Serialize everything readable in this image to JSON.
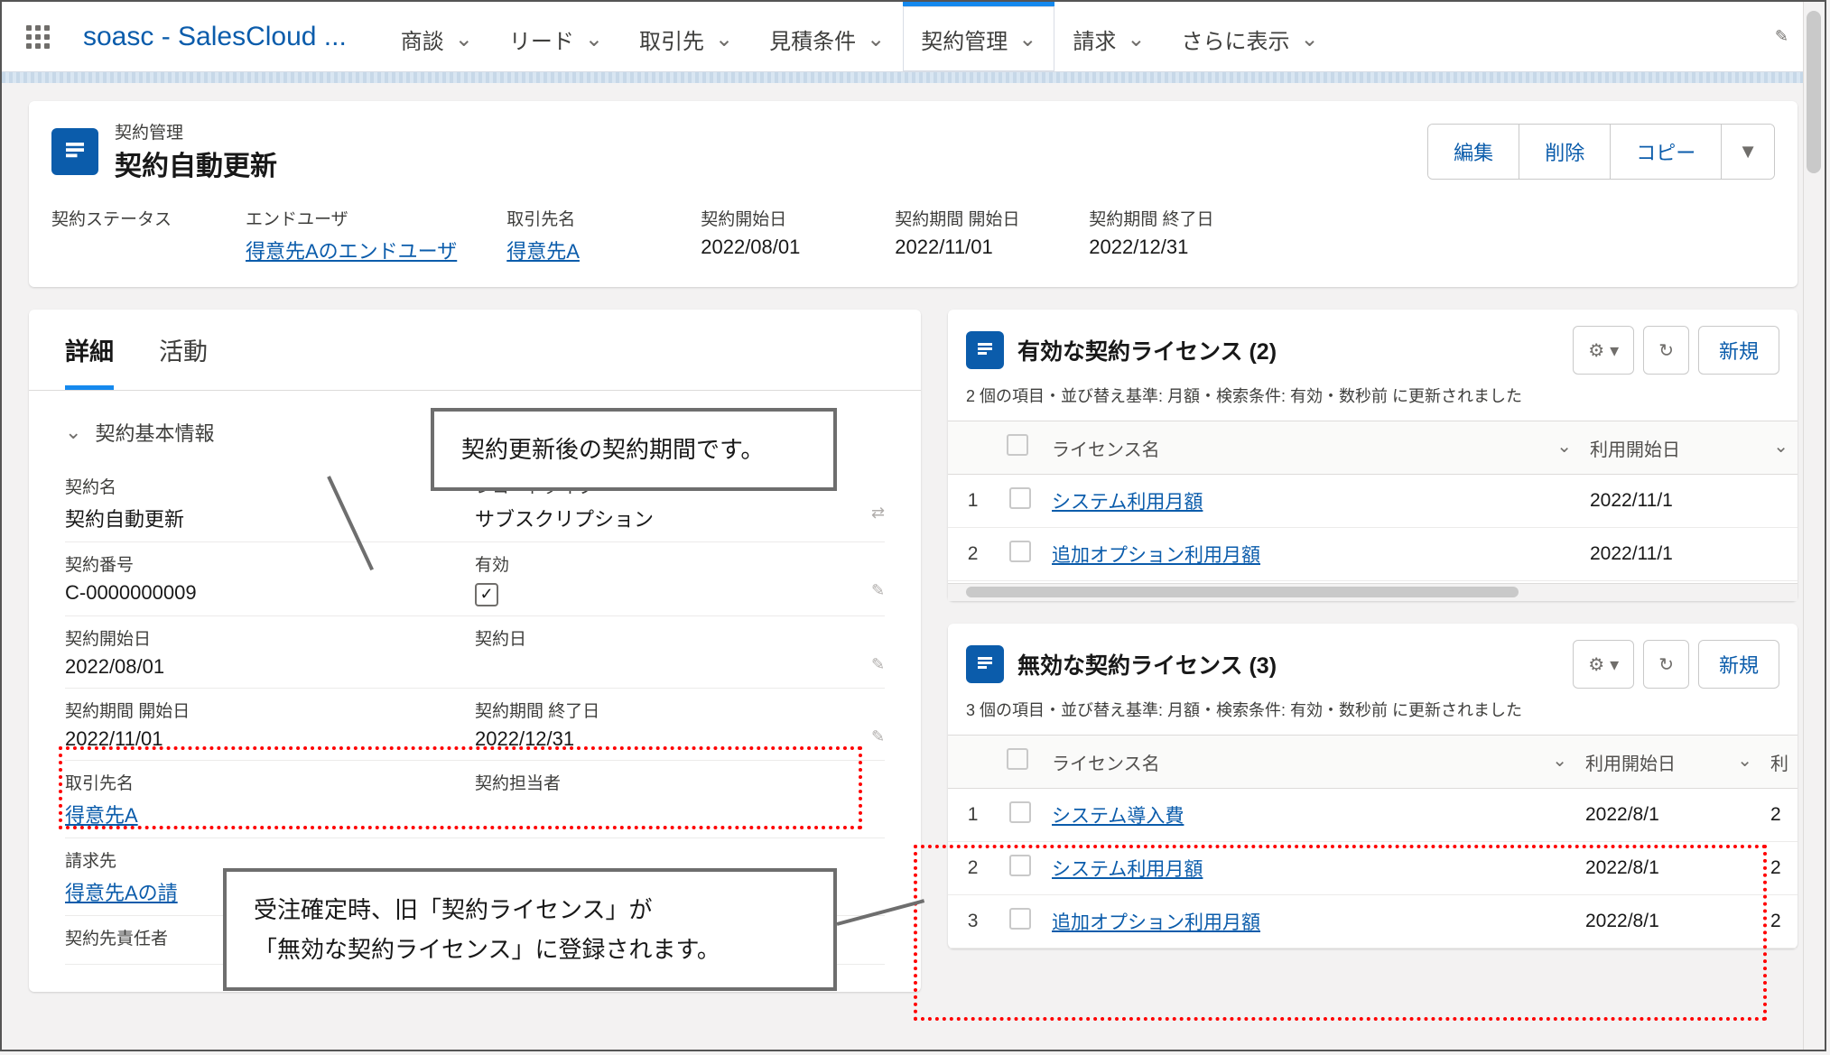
{
  "app": {
    "name": "soasc - SalesCloud ..."
  },
  "nav": {
    "items": [
      {
        "label": "商談"
      },
      {
        "label": "リード"
      },
      {
        "label": "取引先"
      },
      {
        "label": "見積条件"
      },
      {
        "label": "契約管理",
        "active": true
      },
      {
        "label": "請求"
      },
      {
        "label": "さらに表示"
      }
    ]
  },
  "record": {
    "object": "契約管理",
    "name": "契約自動更新",
    "actions": {
      "edit": "編集",
      "delete": "削除",
      "copy": "コピー"
    },
    "summary": {
      "status_lbl": "契約ステータス",
      "status_val": "",
      "enduser_lbl": "エンドユーザ",
      "enduser_val": "得意先Aのエンドユーザ",
      "account_lbl": "取引先名",
      "account_val": "得意先A",
      "start_lbl": "契約開始日",
      "start_val": "2022/08/01",
      "period_start_lbl": "契約期間 開始日",
      "period_start_val": "2022/11/01",
      "period_end_lbl": "契約期間 終了日",
      "period_end_val": "2022/12/31"
    }
  },
  "tabs": {
    "detail": "詳細",
    "activity": "活動"
  },
  "section": {
    "title": "契約基本情報"
  },
  "details": {
    "name_lbl": "契約名",
    "name_val": "契約自動更新",
    "rectype_lbl": "レコードタイプ",
    "rectype_val": "サブスクリプション",
    "num_lbl": "契約番号",
    "num_val": "C-0000000009",
    "valid_lbl": "有効",
    "startdate_lbl": "契約開始日",
    "startdate_val": "2022/08/01",
    "contractdate_lbl": "契約日",
    "period_start_lbl": "契約期間 開始日",
    "period_start_val": "2022/11/01",
    "period_end_lbl": "契約期間 終了日",
    "period_end_val": "2022/12/31",
    "account_lbl": "取引先名",
    "account_val": "得意先A",
    "owner_lbl": "契約担当者",
    "billto_lbl": "請求先",
    "billto_val": "得意先Aの請",
    "resp_lbl": "契約先責任者"
  },
  "related_valid": {
    "title": "有効な契約ライセンス (2)",
    "sub": "2 個の項目・並び替え基準: 月額・検索条件: 有効・数秒前 に更新されました",
    "new": "新規",
    "col_name": "ライセンス名",
    "col_start": "利用開始日",
    "rows": [
      {
        "idx": "1",
        "name": "システム利用月額",
        "start": "2022/11/1"
      },
      {
        "idx": "2",
        "name": "追加オプション利用月額",
        "start": "2022/11/1"
      }
    ]
  },
  "related_invalid": {
    "title": "無効な契約ライセンス (3)",
    "sub": "3 個の項目・並び替え基準: 月額・検索条件: 有効・数秒前 に更新されました",
    "new": "新規",
    "col_name": "ライセンス名",
    "col_start": "利用開始日",
    "col_extra": "利",
    "rows": [
      {
        "idx": "1",
        "name": "システム導入費",
        "start": "2022/8/1",
        "extra": "2"
      },
      {
        "idx": "2",
        "name": "システム利用月額",
        "start": "2022/8/1",
        "extra": "2"
      },
      {
        "idx": "3",
        "name": "追加オプション利用月額",
        "start": "2022/8/1",
        "extra": "2"
      }
    ]
  },
  "callouts": {
    "c1": "契約更新後の契約期間です。",
    "c2a": "受注確定時、旧「契約ライセンス」が",
    "c2b": "「無効な契約ライセンス」に登録されます。"
  }
}
